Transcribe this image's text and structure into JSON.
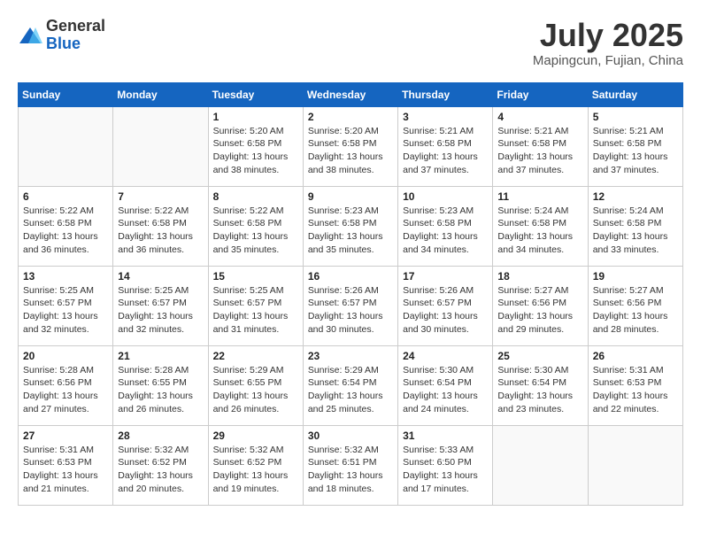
{
  "header": {
    "logo_general": "General",
    "logo_blue": "Blue",
    "month_title": "July 2025",
    "location": "Mapingcun, Fujian, China"
  },
  "weekdays": [
    "Sunday",
    "Monday",
    "Tuesday",
    "Wednesday",
    "Thursday",
    "Friday",
    "Saturday"
  ],
  "weeks": [
    [
      {
        "day": "",
        "info": ""
      },
      {
        "day": "",
        "info": ""
      },
      {
        "day": "1",
        "info": "Sunrise: 5:20 AM\nSunset: 6:58 PM\nDaylight: 13 hours and 38 minutes."
      },
      {
        "day": "2",
        "info": "Sunrise: 5:20 AM\nSunset: 6:58 PM\nDaylight: 13 hours and 38 minutes."
      },
      {
        "day": "3",
        "info": "Sunrise: 5:21 AM\nSunset: 6:58 PM\nDaylight: 13 hours and 37 minutes."
      },
      {
        "day": "4",
        "info": "Sunrise: 5:21 AM\nSunset: 6:58 PM\nDaylight: 13 hours and 37 minutes."
      },
      {
        "day": "5",
        "info": "Sunrise: 5:21 AM\nSunset: 6:58 PM\nDaylight: 13 hours and 37 minutes."
      }
    ],
    [
      {
        "day": "6",
        "info": "Sunrise: 5:22 AM\nSunset: 6:58 PM\nDaylight: 13 hours and 36 minutes."
      },
      {
        "day": "7",
        "info": "Sunrise: 5:22 AM\nSunset: 6:58 PM\nDaylight: 13 hours and 36 minutes."
      },
      {
        "day": "8",
        "info": "Sunrise: 5:22 AM\nSunset: 6:58 PM\nDaylight: 13 hours and 35 minutes."
      },
      {
        "day": "9",
        "info": "Sunrise: 5:23 AM\nSunset: 6:58 PM\nDaylight: 13 hours and 35 minutes."
      },
      {
        "day": "10",
        "info": "Sunrise: 5:23 AM\nSunset: 6:58 PM\nDaylight: 13 hours and 34 minutes."
      },
      {
        "day": "11",
        "info": "Sunrise: 5:24 AM\nSunset: 6:58 PM\nDaylight: 13 hours and 34 minutes."
      },
      {
        "day": "12",
        "info": "Sunrise: 5:24 AM\nSunset: 6:58 PM\nDaylight: 13 hours and 33 minutes."
      }
    ],
    [
      {
        "day": "13",
        "info": "Sunrise: 5:25 AM\nSunset: 6:57 PM\nDaylight: 13 hours and 32 minutes."
      },
      {
        "day": "14",
        "info": "Sunrise: 5:25 AM\nSunset: 6:57 PM\nDaylight: 13 hours and 32 minutes."
      },
      {
        "day": "15",
        "info": "Sunrise: 5:25 AM\nSunset: 6:57 PM\nDaylight: 13 hours and 31 minutes."
      },
      {
        "day": "16",
        "info": "Sunrise: 5:26 AM\nSunset: 6:57 PM\nDaylight: 13 hours and 30 minutes."
      },
      {
        "day": "17",
        "info": "Sunrise: 5:26 AM\nSunset: 6:57 PM\nDaylight: 13 hours and 30 minutes."
      },
      {
        "day": "18",
        "info": "Sunrise: 5:27 AM\nSunset: 6:56 PM\nDaylight: 13 hours and 29 minutes."
      },
      {
        "day": "19",
        "info": "Sunrise: 5:27 AM\nSunset: 6:56 PM\nDaylight: 13 hours and 28 minutes."
      }
    ],
    [
      {
        "day": "20",
        "info": "Sunrise: 5:28 AM\nSunset: 6:56 PM\nDaylight: 13 hours and 27 minutes."
      },
      {
        "day": "21",
        "info": "Sunrise: 5:28 AM\nSunset: 6:55 PM\nDaylight: 13 hours and 26 minutes."
      },
      {
        "day": "22",
        "info": "Sunrise: 5:29 AM\nSunset: 6:55 PM\nDaylight: 13 hours and 26 minutes."
      },
      {
        "day": "23",
        "info": "Sunrise: 5:29 AM\nSunset: 6:54 PM\nDaylight: 13 hours and 25 minutes."
      },
      {
        "day": "24",
        "info": "Sunrise: 5:30 AM\nSunset: 6:54 PM\nDaylight: 13 hours and 24 minutes."
      },
      {
        "day": "25",
        "info": "Sunrise: 5:30 AM\nSunset: 6:54 PM\nDaylight: 13 hours and 23 minutes."
      },
      {
        "day": "26",
        "info": "Sunrise: 5:31 AM\nSunset: 6:53 PM\nDaylight: 13 hours and 22 minutes."
      }
    ],
    [
      {
        "day": "27",
        "info": "Sunrise: 5:31 AM\nSunset: 6:53 PM\nDaylight: 13 hours and 21 minutes."
      },
      {
        "day": "28",
        "info": "Sunrise: 5:32 AM\nSunset: 6:52 PM\nDaylight: 13 hours and 20 minutes."
      },
      {
        "day": "29",
        "info": "Sunrise: 5:32 AM\nSunset: 6:52 PM\nDaylight: 13 hours and 19 minutes."
      },
      {
        "day": "30",
        "info": "Sunrise: 5:32 AM\nSunset: 6:51 PM\nDaylight: 13 hours and 18 minutes."
      },
      {
        "day": "31",
        "info": "Sunrise: 5:33 AM\nSunset: 6:50 PM\nDaylight: 13 hours and 17 minutes."
      },
      {
        "day": "",
        "info": ""
      },
      {
        "day": "",
        "info": ""
      }
    ]
  ]
}
